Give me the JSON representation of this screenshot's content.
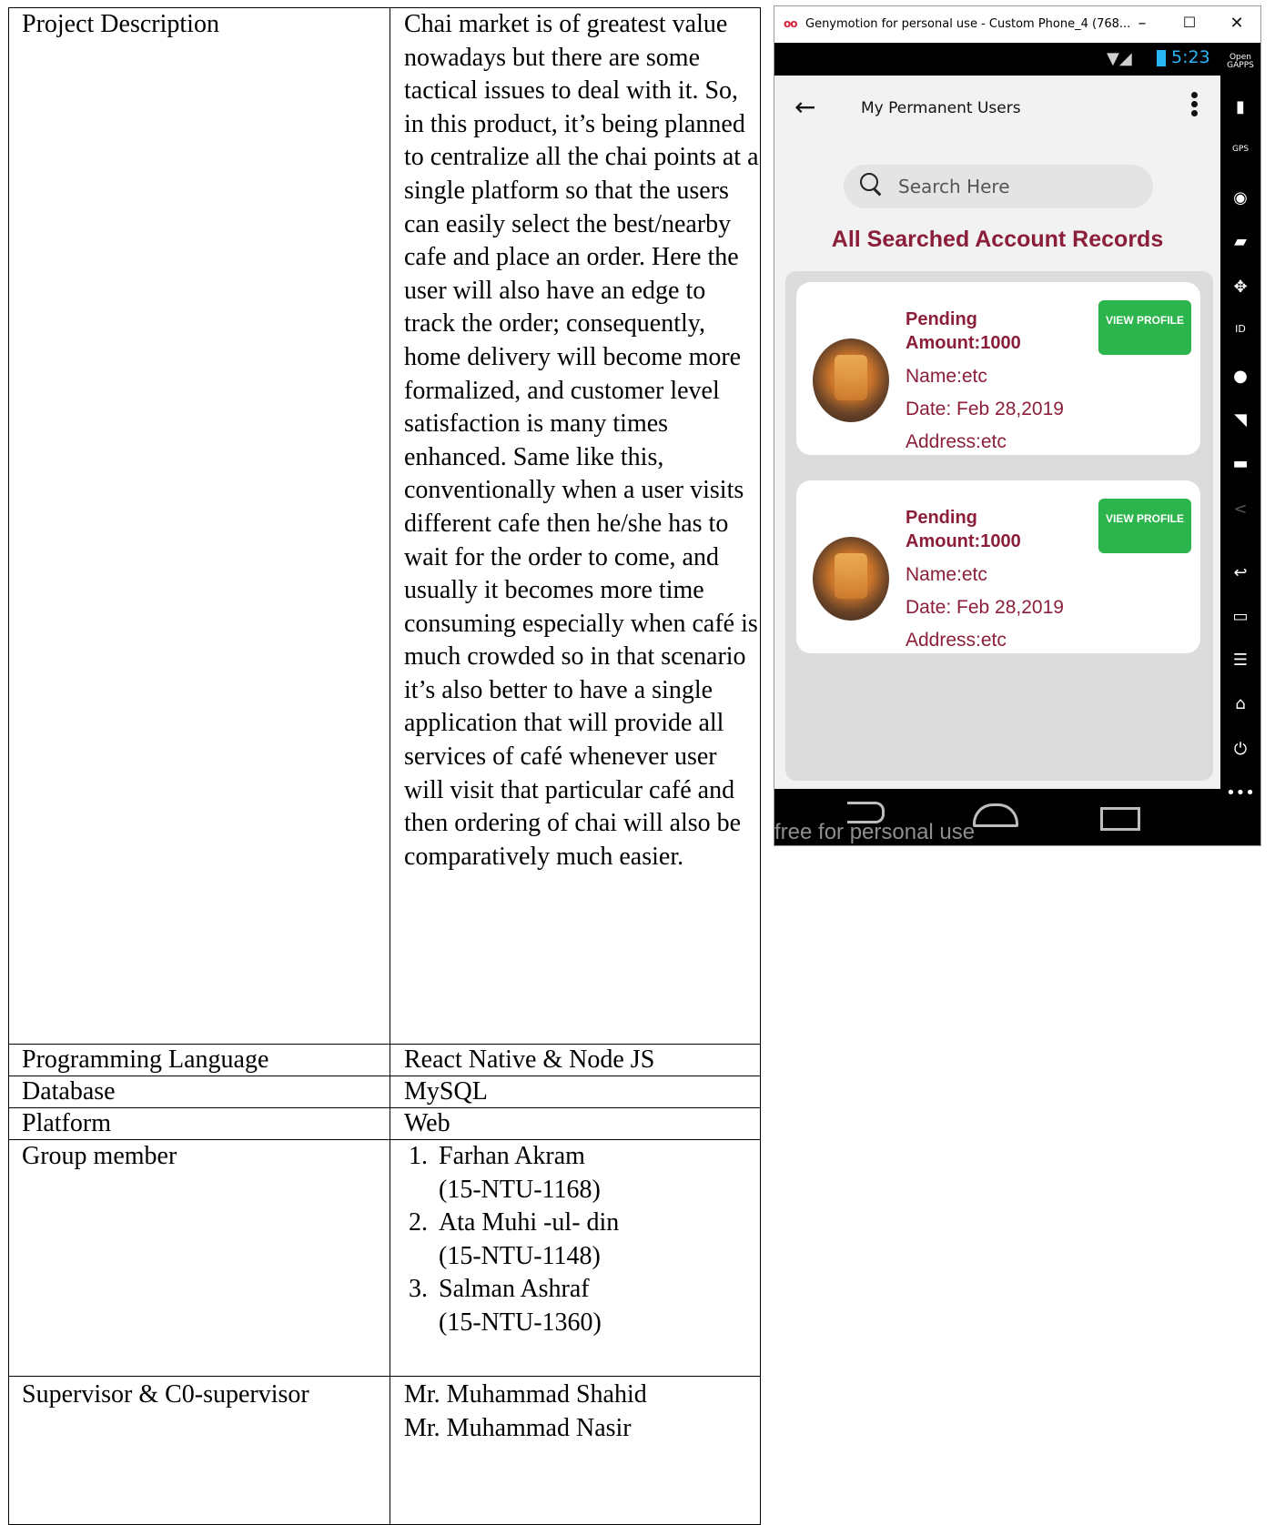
{
  "document": {
    "rows": {
      "description": {
        "label": "Project Description",
        "value": "Chai market is of greatest value nowadays but there are some tactical issues to deal with it. So, in this product, it’s being planned to centralize all the chai points at a single platform so that the users can easily select the best/nearby cafe and place an order. Here the user will also have an edge to track the order; consequently, home delivery will become more formalized, and customer level satisfaction is many times enhanced. Same like this, conventionally when a user visits different cafe then he/she has to wait for the order to come, and usually it becomes more time consuming especially when café is much crowded so in that scenario it’s also better to have a single application that will provide all services of café whenever user will visit that particular café and then ordering of chai will also be comparatively much easier."
      },
      "language": {
        "label": "Programming Language",
        "value": "React Native & Node JS"
      },
      "database": {
        "label": "Database",
        "value": "MySQL"
      },
      "platform": {
        "label": "Platform",
        "value": "Web"
      },
      "group": {
        "label": "Group member",
        "members": [
          {
            "num": "1.",
            "name": "Farhan Akram",
            "id": "(15-NTU-1168)"
          },
          {
            "num": "2.",
            "name": "Ata Muhi -ul- din",
            "id": "(15-NTU-1148)"
          },
          {
            "num": "3.",
            "name": "Salman Ashraf",
            "id": "(15-NTU-1360)"
          }
        ]
      },
      "supervisor": {
        "label": "Supervisor & C0-supervisor",
        "line1": "Mr. Muhammad Shahid",
        "line2": "Mr. Muhammad Nasir"
      }
    }
  },
  "emulator": {
    "window_title": "Genymotion for personal use - Custom Phone_4 (768...",
    "window_buttons": {
      "minimize": "–",
      "maximize": "☐",
      "close": "✕"
    },
    "status_bar": {
      "time": "5:23"
    },
    "app": {
      "title": "My Permanent Users",
      "search_placeholder": "Search Here",
      "section_title": "All Searched Account Records",
      "records": [
        {
          "status": "Pending",
          "amount": "Amount:1000",
          "name": "Name:etc",
          "date": "Date: Feb 28,2019",
          "address": "Address:etc",
          "button": "VIEW PROFILE"
        },
        {
          "status": "Pending",
          "amount": "Amount:1000",
          "name": "Name:etc",
          "date": "Date: Feb 28,2019",
          "address": "Address:etc",
          "button": "VIEW PROFILE"
        }
      ]
    },
    "watermark": "free for personal use",
    "sidebar_icons": [
      "open-gapps-icon",
      "battery-icon",
      "gps-icon",
      "webcam-icon",
      "media-icon",
      "dpad-icon",
      "id-icon",
      "disk-icon",
      "cast-icon",
      "sms-icon",
      "share-icon",
      "back-icon",
      "recent-apps-icon",
      "menu-icon",
      "home-icon",
      "power-icon",
      "more-icon"
    ],
    "sidebar_texts": {
      "gapps": "Open GAPPS",
      "gps": "GPS",
      "id": "ID"
    }
  }
}
